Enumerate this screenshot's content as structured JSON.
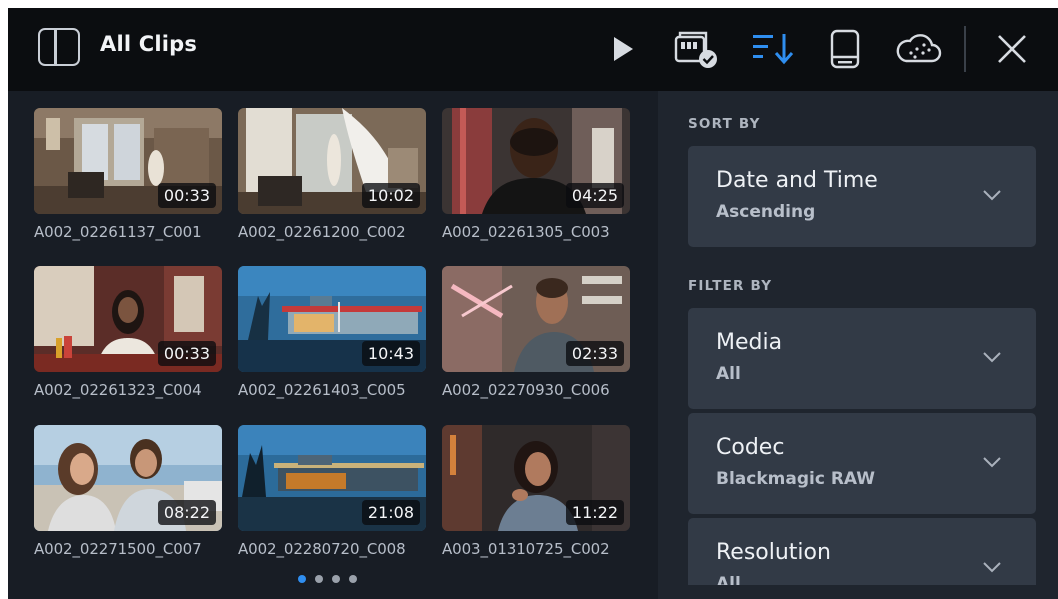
{
  "header": {
    "title": "All Clips",
    "icons": [
      "sidebar-toggle-icon",
      "play-icon",
      "card-check-icon",
      "sort-icon",
      "drive-icon",
      "cloud-icon",
      "close-icon"
    ],
    "accent": "#2f8ef0"
  },
  "clips": [
    {
      "name": "A002_02261137_C001",
      "duration": "00:33"
    },
    {
      "name": "A002_02261200_C002",
      "duration": "10:02"
    },
    {
      "name": "A002_02261305_C003",
      "duration": "04:25"
    },
    {
      "name": "A002_02261323_C004",
      "duration": "00:33"
    },
    {
      "name": "A002_02261403_C005",
      "duration": "10:43"
    },
    {
      "name": "A002_02270930_C006",
      "duration": "02:33"
    },
    {
      "name": "A002_02271500_C007",
      "duration": "08:22"
    },
    {
      "name": "A002_02280720_C008",
      "duration": "21:08"
    },
    {
      "name": "A003_01310725_C002",
      "duration": "11:22"
    }
  ],
  "pagination": {
    "pages": 4,
    "current": 1
  },
  "sort": {
    "label": "SORT BY",
    "title": "Date and Time",
    "value": "Ascending"
  },
  "filter": {
    "label": "FILTER BY",
    "items": [
      {
        "title": "Media",
        "value": "All"
      },
      {
        "title": "Codec",
        "value": "Blackmagic RAW"
      },
      {
        "title": "Resolution",
        "value": "All"
      }
    ]
  }
}
